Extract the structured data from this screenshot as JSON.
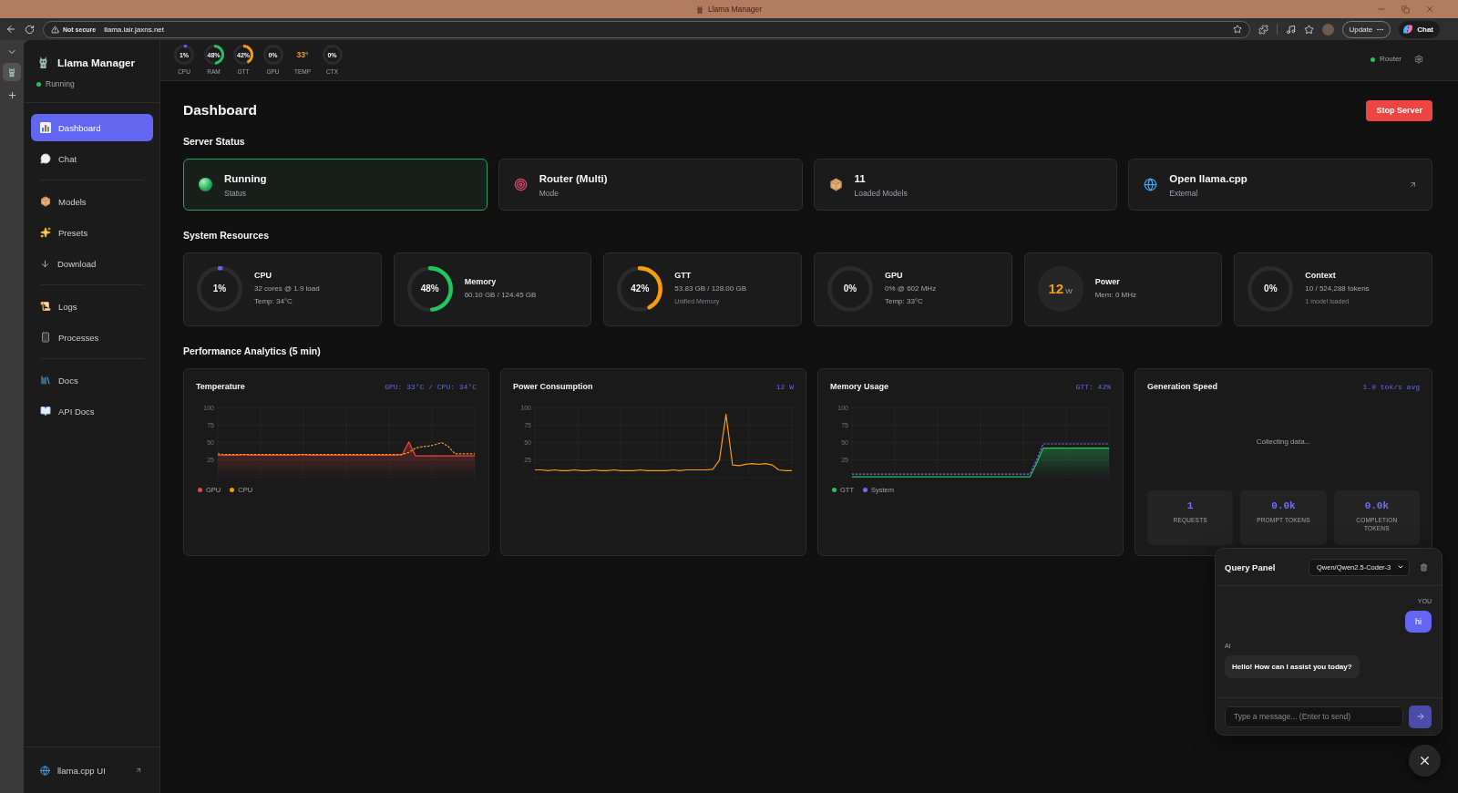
{
  "browser": {
    "window_title": "Llama Manager",
    "security_label": "Not secure",
    "url": "llama.lair.jaxns.net",
    "update_button": "Update",
    "chat_button": "Chat"
  },
  "sidebar": {
    "app_name": "Llama Manager",
    "status": {
      "label": "Running",
      "online": true
    },
    "nav_sections": [
      {
        "items": [
          {
            "label": "Dashboard",
            "selected": true
          },
          {
            "label": "Chat",
            "selected": false
          }
        ]
      },
      {
        "items": [
          {
            "label": "Models",
            "selected": false
          },
          {
            "label": "Presets",
            "selected": false
          },
          {
            "label": "Download",
            "selected": false
          }
        ]
      },
      {
        "items": [
          {
            "label": "Logs",
            "selected": false
          },
          {
            "label": "Processes",
            "selected": false
          }
        ]
      },
      {
        "items": [
          {
            "label": "Docs",
            "selected": false
          },
          {
            "label": "API Docs",
            "selected": false
          }
        ]
      }
    ],
    "footer_link": "llama.cpp UI"
  },
  "top_bar": {
    "metrics": [
      {
        "kind": "ring",
        "value": "1%",
        "label": "CPU",
        "level": 0.01,
        "color": "#6366f1"
      },
      {
        "kind": "ring",
        "value": "48%",
        "label": "RAM",
        "level": 0.48,
        "color": "#22c55e"
      },
      {
        "kind": "ring",
        "value": "42%",
        "label": "GTT",
        "level": 0.42,
        "color": "#f59e0b"
      },
      {
        "kind": "ring",
        "value": "0%",
        "label": "GPU"
      },
      {
        "kind": "reading",
        "value": "33°",
        "label": "TEMP",
        "color": "#f59e0b"
      },
      {
        "kind": "ring",
        "value": "0%",
        "label": "CTX"
      }
    ],
    "router": {
      "label": "Router",
      "online": true
    }
  },
  "page": {
    "title": "Dashboard",
    "stop_button": "Stop Server"
  },
  "server_status": {
    "heading": "Server Status",
    "cards": [
      {
        "kind": "status",
        "value": "Running",
        "caption": "Status",
        "highlighted": true
      },
      {
        "kind": "mode",
        "value": "Router (Multi)",
        "caption": "Mode",
        "highlighted": false
      },
      {
        "kind": "count",
        "value": "11",
        "caption": "Loaded Models",
        "highlighted": false
      },
      {
        "kind": "link",
        "value": "Open llama.cpp",
        "caption": "External",
        "highlighted": false
      }
    ]
  },
  "system_resources": {
    "heading": "System Resources",
    "cards": [
      {
        "kind": "ring",
        "title": "CPU",
        "value": "1%",
        "level": 0.01,
        "color": "#6366f1",
        "lines": [
          {
            "kind": "detail",
            "text": "32 cores @ 1.9 load"
          },
          {
            "kind": "detail",
            "text": "Temp: 34°C"
          }
        ]
      },
      {
        "kind": "ring",
        "title": "Memory",
        "value": "48%",
        "level": 0.48,
        "color": "#22c55e",
        "lines": [
          {
            "kind": "detail",
            "text": "60.10 GB / 124.45 GB"
          }
        ]
      },
      {
        "kind": "ring",
        "title": "GTT",
        "value": "42%",
        "level": 0.42,
        "color": "#f59e0b",
        "lines": [
          {
            "kind": "detail",
            "text": "53.83 GB / 128.00 GB"
          },
          {
            "kind": "note",
            "text": "Unified Memory"
          }
        ]
      },
      {
        "kind": "ring",
        "title": "GPU",
        "value": "0%",
        "lines": [
          {
            "kind": "detail",
            "text": "0% @ 602 MHz"
          },
          {
            "kind": "detail",
            "text": "Temp: 33°C"
          }
        ]
      },
      {
        "kind": "disc",
        "title": "Power",
        "value": "12",
        "unit": "W",
        "color": "#f59e0b",
        "lines": [
          {
            "kind": "detail",
            "text": "Mem: 0 MHz"
          }
        ]
      },
      {
        "kind": "ring",
        "title": "Context",
        "value": "0%",
        "lines": [
          {
            "kind": "detail",
            "text": "10 / 524,288 tokens"
          },
          {
            "kind": "note",
            "text": "1 model loaded"
          }
        ]
      }
    ]
  },
  "analytics": {
    "heading": "Performance Analytics (5 min)",
    "cards": [
      {
        "kind": "chart",
        "reading": "GPU: 33°C / CPU: 34°C",
        "chart_data": {
          "type": "area",
          "title": "Temperature",
          "grid": true,
          "ylim": [
            0,
            100
          ],
          "yticks": [
            25,
            50,
            75,
            100
          ],
          "series": [
            {
              "name": "GPU",
              "color": "#ef4444",
              "values": [
                32,
                32,
                32,
                32,
                33,
                32,
                32,
                32,
                32,
                32,
                32,
                32,
                32,
                33,
                32,
                32,
                32,
                32,
                32,
                32,
                32,
                32,
                32,
                32,
                32,
                32,
                32,
                32,
                33,
                51,
                31,
                31,
                31,
                31,
                31,
                31,
                31,
                31,
                31,
                31
              ]
            },
            {
              "name": "CPU",
              "type": "line",
              "line_style": "dashed",
              "color": "#f59e0b",
              "values": [
                34,
                33,
                33,
                33,
                33,
                33,
                33,
                33,
                33,
                33,
                33,
                33,
                33,
                33,
                33,
                33,
                33,
                33,
                33,
                33,
                33,
                33,
                33,
                33,
                33,
                33,
                33,
                33,
                33,
                36,
                42,
                44,
                45,
                47,
                50,
                44,
                34,
                34,
                34,
                34
              ]
            }
          ]
        }
      },
      {
        "kind": "chart",
        "reading": "12 W",
        "chart_data": {
          "type": "line",
          "title": "Power Consumption",
          "grid": true,
          "ylim": [
            0,
            100
          ],
          "yticks": [
            25,
            50,
            75,
            100
          ],
          "series": [
            {
              "color": "#f59e0b",
              "values": [
                11,
                11,
                10,
                11,
                10,
                10,
                11,
                10,
                10,
                11,
                10,
                10,
                11,
                10,
                10,
                10,
                11,
                10,
                10,
                10,
                10,
                11,
                10,
                11,
                11,
                11,
                11,
                12,
                25,
                90,
                18,
                17,
                19,
                20,
                19,
                20,
                18,
                11,
                10,
                10
              ]
            }
          ]
        }
      },
      {
        "kind": "chart",
        "reading": "GTT: 42%",
        "chart_data": {
          "type": "area",
          "title": "Memory Usage",
          "grid": true,
          "ylim": [
            0,
            100
          ],
          "yticks": [
            25,
            50,
            75,
            100
          ],
          "series": [
            {
              "name": "GTT",
              "color": "#22c55e",
              "values": [
                1,
                1,
                1,
                1,
                1,
                1,
                1,
                1,
                1,
                1,
                1,
                1,
                1,
                1,
                1,
                1,
                1,
                1,
                1,
                1,
                1,
                1,
                1,
                1,
                1,
                1,
                1,
                1,
                20,
                42,
                42,
                42,
                42,
                42,
                42,
                42,
                42,
                42,
                42,
                42
              ]
            },
            {
              "name": "System",
              "type": "line",
              "line_style": "dashed",
              "color": "#8b5cf6",
              "values": [
                5,
                5,
                5,
                5,
                5,
                5,
                5,
                5,
                5,
                5,
                5,
                5,
                5,
                5,
                5,
                5,
                5,
                5,
                5,
                5,
                5,
                5,
                5,
                5,
                5,
                5,
                5,
                5,
                25,
                48,
                48,
                48,
                48,
                48,
                48,
                48,
                48,
                48,
                48,
                48
              ]
            }
          ]
        }
      },
      {
        "kind": "stats",
        "title": "Generation Speed",
        "reading": "1.0 tok/s avg",
        "message": "Collecting data...",
        "stats": [
          {
            "value": "1",
            "label": "REQUESTS"
          },
          {
            "value": "0.0k",
            "label": "PROMPT TOKENS"
          },
          {
            "value": "0.0k",
            "label": "COMPLETION TOKENS"
          }
        ]
      }
    ]
  },
  "query_panel": {
    "title": "Query Panel",
    "model": "Qwen/Qwen2.5-Coder-3",
    "messages": [
      {
        "kind": "user",
        "sender": "YOU",
        "text": "hi"
      },
      {
        "kind": "assistant",
        "sender": "AI",
        "text": "Hello! How can I assist you today?"
      }
    ],
    "input": {
      "placeholder": "Type a message... (Enter to send)"
    }
  }
}
